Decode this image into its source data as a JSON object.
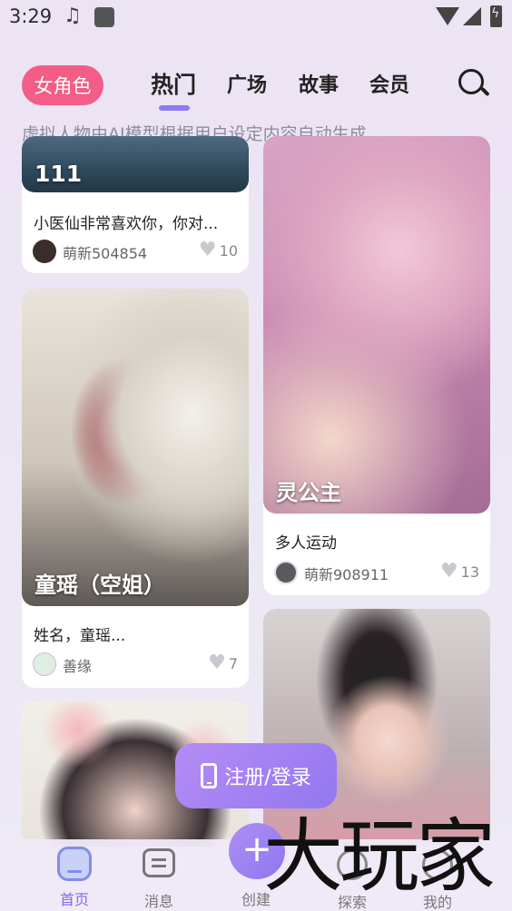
{
  "status_bar": {
    "time": "3:29",
    "icons": [
      "music-note-icon",
      "app-square-icon",
      "wifi-icon",
      "signal-icon",
      "battery-icon"
    ]
  },
  "nav": {
    "chip": "女角色",
    "tabs": [
      "热门",
      "广场",
      "故事",
      "会员"
    ],
    "active_tab": "热门",
    "search_icon": "search-icon"
  },
  "subtitle": "虚拟人物由AI模型根据用户设定内容自动生成",
  "cards": {
    "c1": {
      "title": "111",
      "desc": "小医仙非常喜欢你，你对...",
      "user": "萌新504854",
      "likes": "10"
    },
    "c2": {
      "title": "童瑶（空姐）",
      "desc": "姓名，童瑶...",
      "user": "善缘",
      "likes": "7"
    },
    "c3": {
      "title": "灵公主",
      "desc": "多人运动",
      "user": "萌新908911",
      "likes": "13"
    }
  },
  "login_button": "注册/登录",
  "bottom_nav": {
    "home": "首页",
    "messages": "消息",
    "create": "创建",
    "explore": "探索",
    "mine": "我的"
  },
  "watermark": "大玩家",
  "colors": {
    "accent": "#8e7bf0",
    "chip": "#f35d86",
    "login": "#9d80f2"
  }
}
